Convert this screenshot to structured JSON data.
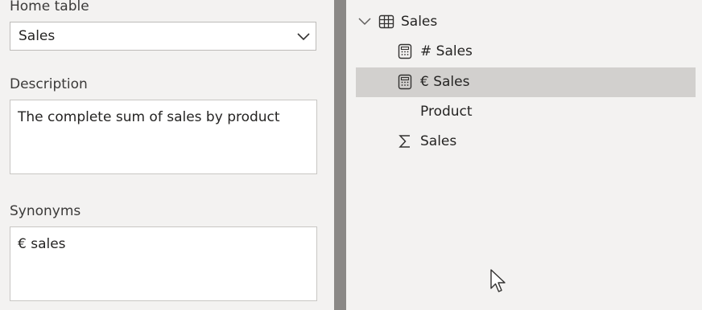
{
  "home_table": {
    "label": "Home table",
    "selected_value": "Sales"
  },
  "description": {
    "label": "Description",
    "value": "The complete sum of sales by product"
  },
  "synonyms": {
    "label": "Synonyms",
    "value": "€ sales"
  },
  "tree": {
    "table": {
      "label": "Sales",
      "icon": "table-icon",
      "expanded": true
    },
    "items": [
      {
        "label": "# Sales",
        "icon": "calculator-icon",
        "selected": false
      },
      {
        "label": "€ Sales",
        "icon": "calculator-icon",
        "selected": true
      },
      {
        "label": "Product",
        "icon": "",
        "selected": false
      },
      {
        "label": "Sales",
        "icon": "sigma-icon",
        "selected": false
      }
    ]
  },
  "colors": {
    "background": "#f3f2f1",
    "divider": "#8a8886",
    "selection": "#d2d0ce"
  }
}
